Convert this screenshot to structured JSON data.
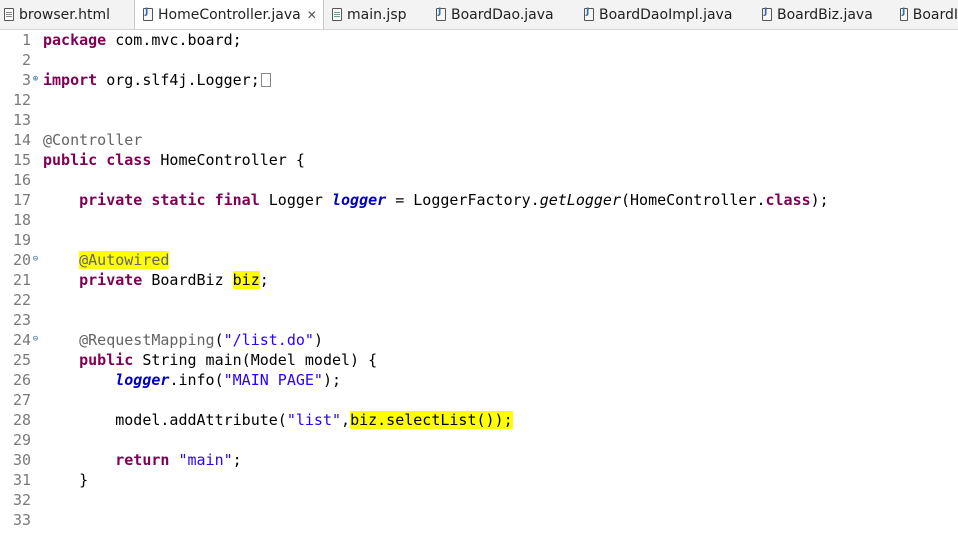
{
  "tabs": [
    {
      "label": "browser.html",
      "icon": "html-file-icon"
    },
    {
      "label": "HomeController.java",
      "icon": "java-file-icon",
      "close": "✕"
    },
    {
      "label": "main.jsp",
      "icon": "jsp-file-icon"
    },
    {
      "label": "BoardDao.java",
      "icon": "java-file-icon"
    },
    {
      "label": "BoardDaoImpl.java",
      "icon": "java-file-icon"
    },
    {
      "label": "BoardBiz.java",
      "icon": "java-file-icon"
    },
    {
      "label": "BoardI",
      "icon": "java-file-icon"
    }
  ],
  "lines": [
    {
      "n": "1",
      "t": "package com.mvc.board;"
    },
    {
      "n": "2",
      "t": ""
    },
    {
      "n": "3",
      "t": "import org.slf4j.Logger;"
    },
    {
      "n": "12",
      "t": ""
    },
    {
      "n": "13",
      "t": ""
    },
    {
      "n": "14",
      "t": "@Controller"
    },
    {
      "n": "15",
      "t": "public class HomeController {"
    },
    {
      "n": "16",
      "t": ""
    },
    {
      "n": "17",
      "t": "    private static final Logger logger = LoggerFactory.getLogger(HomeController.class);"
    },
    {
      "n": "18",
      "t": ""
    },
    {
      "n": "19",
      "t": ""
    },
    {
      "n": "20",
      "t": "    @Autowired"
    },
    {
      "n": "21",
      "t": "    private BoardBiz biz;"
    },
    {
      "n": "22",
      "t": ""
    },
    {
      "n": "23",
      "t": ""
    },
    {
      "n": "24",
      "t": "    @RequestMapping(\"/list.do\")"
    },
    {
      "n": "25",
      "t": "    public String main(Model model) {"
    },
    {
      "n": "26",
      "t": "        logger.info(\"MAIN PAGE\");"
    },
    {
      "n": "27",
      "t": ""
    },
    {
      "n": "28",
      "t": "        model.addAttribute(\"list\",biz.selectList());"
    },
    {
      "n": "29",
      "t": ""
    },
    {
      "n": "30",
      "t": "        return \"main\";"
    },
    {
      "n": "31",
      "t": "    }"
    },
    {
      "n": "32",
      "t": ""
    },
    {
      "n": "33",
      "t": ""
    }
  ],
  "fold_markers": {
    "line3": "⊕",
    "line20": "⊖",
    "line24": "⊖"
  },
  "colors": {
    "keyword": "#7f0055",
    "annotation": "#646464",
    "string": "#2a00ff",
    "field": "#0000c0",
    "highlight": "#ffff00"
  }
}
